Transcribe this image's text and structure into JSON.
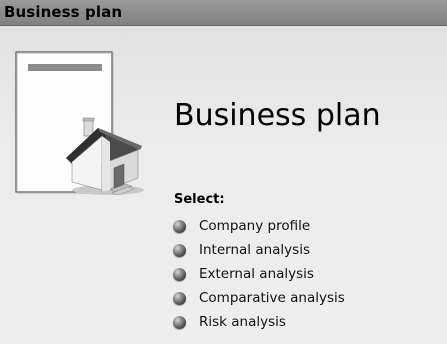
{
  "window": {
    "title": "Business plan"
  },
  "main": {
    "heading": "Business plan",
    "select_label": "Select:",
    "menu": [
      {
        "label": "Company profile",
        "icon": "bullet-icon"
      },
      {
        "label": "Internal analysis",
        "icon": "bullet-icon"
      },
      {
        "label": "External analysis",
        "icon": "bullet-icon"
      },
      {
        "label": "Comparative analysis",
        "icon": "bullet-icon"
      },
      {
        "label": "Risk analysis",
        "icon": "bullet-icon"
      }
    ],
    "illustration": {
      "icon": "document-house-icon"
    }
  },
  "colors": {
    "titlebar": "#8a8a8a",
    "background": "#e9e9e9",
    "roof": "#3a3a3a",
    "house_wall": "#f2f2f2"
  }
}
